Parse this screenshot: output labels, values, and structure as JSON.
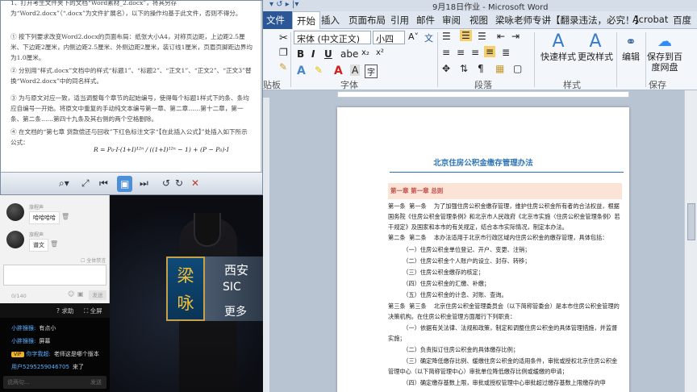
{
  "word": {
    "title": "9月18日作业 - Microsoft Word",
    "tabs": [
      "文件",
      "开始",
      "插入",
      "页面布局",
      "引用",
      "邮件",
      "审阅",
      "视图",
      "梁咏老师专讲【翻录违法，必究！】",
      "Acrobat",
      "百度"
    ],
    "font_name": "宋体 (中文正文)",
    "font_size": "小四",
    "group_font": "字体",
    "group_paragraph": "段落",
    "group_styles": "样式",
    "group_save": "保存",
    "group_clipboard": "贴板",
    "quick_styles": "快速样式",
    "change_styles": "更改样式",
    "edit": "编辑",
    "save_baidu": "保存到百度网盘",
    "doc_title": "北京住房公积金缴存管理办法",
    "chapter": "第一章  第一章    总则",
    "paragraphs": [
      "第一条  第一条    为了加强住房公积金缴存管理，维护住房公积金所有者的合法权益，根据国务院《住房公积金管理条例》和北京市人民政府《北京市实施〈住房公积金管理条例〉若干规定》及国家和本市的有关规定，结合本市实际情况，制定本办法。",
      "第二条  第二条    本办法适用于北京市行政区域内住房公积金的缴存管理，具体包括：",
      "        （一）住房公积金单位登记、开户、变更、注销；",
      "        （二）住房公积金个人账户的设立、封存、转移；",
      "        （三）住房公积金缴存的核定；",
      "        （四）住房公积金的汇缴、补缴；",
      "        （五）住房公积金的计息、对账、查询。",
      "第三条  第三条    北京住房公积金管理委员会（以下简称管委会）是本市住房公积金管理的决策机构。在住房公积金管理方面履行下列职责：",
      "        （一）依据有关法律、法规和政策，制定和调整住房公积金的具体管理措施，并监督实施；",
      "        （二）负责拟订住房公积金的具体缴存比例；",
      "        （三）确定降低缴存比例、缓缴住房公积金的适用条件，审批或授权北京住房公积金管理中心（以下简称管理中心）审批单位降低缴存比例或缓缴的申请；",
      "        （四）确定缴存基数上限，审批或授权管理中心审批超过缴存基数上限缴存的申"
    ]
  },
  "pdf": {
    "lines": [
      "1、打开考生文件夹下的文档“Word素材_2.docx”，将其另存为“Word2.docx”（“.docx”为文件扩展名），以下的操作均基于此文件，否则不得分。",
      "① 按下列要求改变Word2.docx的页面布局：纸张大小A4，对称页边距，上边距2.5厘米、下边距2厘米，内侧边距2.5厘米、外侧边距2厘米，装订线1厘米，页眉页脚距边界均为1.0厘米。",
      "② 分别用“样式.docx”文档中的样式“标题1”、“标题2”、“正文1”、“正文2”、“正文3”替换“Word2.docx”中的同名样式。",
      "③ 为与原文对应一致，适当调整每个章节的起始编号，使得每个标题1样式下的条、条均应自编号一开始。将原文中重复的手动纯文本编号第一章、第二章……第十二章，第一条、第二条……第四十九条及其右侧的两个空格删除。",
      "④ 在文档的“第七章  贷款偿还与回收”下红色标注文字“【在此插入公式】”处插入如下所示公式："
    ],
    "formula": "R = P₀·I·(1+I)¹²ⁿ / ((1+I)¹²ⁿ − 1) + (P − P₀)·I"
  },
  "chat": {
    "messages": [
      {
        "name": "旅程声",
        "text": "哈哈哈哈"
      },
      {
        "name": "旅程声",
        "text": "谱文"
      }
    ],
    "mute_all": "全体禁言",
    "count": "0/140",
    "send": "发送",
    "help": "求助",
    "fullscreen": "全屏",
    "danmaku": [
      {
        "user": "小胖猴猴:",
        "text": "有点小",
        "badge": ""
      },
      {
        "user": "小胖猴猴:",
        "text": "屏幕",
        "badge": ""
      },
      {
        "user": "你字我超:",
        "text": "老师这是哪个版本",
        "badge": "VIP"
      },
      {
        "user": "用户5295259046705",
        "text": "来了",
        "badge": ""
      }
    ],
    "say_placeholder": "说两句…",
    "say_send": "发送"
  },
  "slide": {
    "name_char_1": "梁",
    "name_char_2": "咏",
    "line1": "西安",
    "line2": "SIC",
    "line3": "更多"
  }
}
